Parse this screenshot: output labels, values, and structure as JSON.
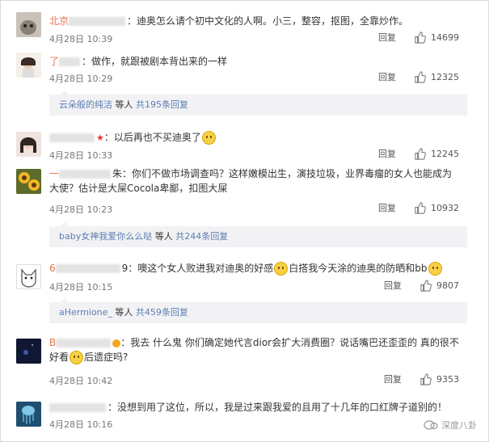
{
  "comments": [
    {
      "name": "北京",
      "text": "：迪奥怎么请个初中文化的人啊。小三，整容，抠图，全靠炒作。",
      "time": "4月28日 10:39",
      "reply_label": "回复",
      "likes": "14699"
    },
    {
      "name": "了",
      "text": "：做作，就跟被剧本背出来的一样",
      "time": "4月28日 10:29",
      "reply_label": "回复",
      "likes": "12325",
      "sub": {
        "user": "云朵般的纯洁",
        "mid": "等人",
        "count": "共195条回复"
      }
    },
    {
      "name": "",
      "text": "：以后再也不买迪奥了",
      "time": "4月28日 10:33",
      "reply_label": "回复",
      "likes": "12245"
    },
    {
      "name": "一",
      "text": "朱：你们不做市场调查吗？这样嫩模出生，演技垃圾，业界毒瘤的女人也能成为大使？估计是大屎Cocola卑鄙，扣图大屎",
      "time": "4月28日 10:23",
      "reply_label": "回复",
      "likes": "10932",
      "sub": {
        "user": "baby女神我爱你么么哒",
        "mid": "等人",
        "count": "共244条回复"
      }
    },
    {
      "name": "6",
      "text_a": "9：噢这个女人败进我对迪奥的好感",
      "text_b": "白搭我今天涂的迪奥的防晒和bb",
      "time": "4月28日 10:15",
      "reply_label": "回复",
      "likes": "9807",
      "sub": {
        "user": "aHermione_",
        "mid": "等人",
        "count": "共459条回复"
      }
    },
    {
      "name": "B",
      "text_a": "：我去 什么鬼 你们确定她代言dior会扩大消费圈？说话嘴巴还歪歪的 真的很不好看",
      "text_b": "后遗症吗?",
      "time": "4月28日 10:42",
      "reply_label": "回复",
      "likes": "9353"
    },
    {
      "name": "",
      "text": "：没想到用了这位，所以，我是过来跟我爱的且用了十几年的口红牌子道别的！",
      "time": "4月28日 10:16"
    }
  ],
  "watermark": "深度八卦",
  "colors": {
    "name": "#eb7350",
    "link": "#5b7db1",
    "meta": "#777777"
  }
}
